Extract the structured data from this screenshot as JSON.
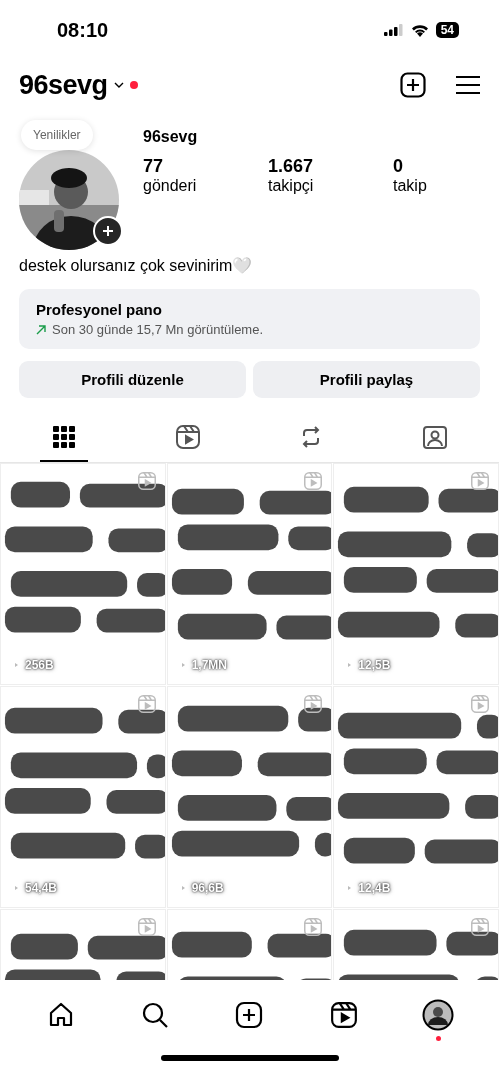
{
  "status_bar": {
    "time": "08:10",
    "battery": "54"
  },
  "header": {
    "username": "96sevg",
    "has_notification": true
  },
  "profile": {
    "note": "Yenilikler",
    "name": "96sevg",
    "stats": [
      {
        "value": "77",
        "label": "gönderi"
      },
      {
        "value": "1.667",
        "label": "takipçi"
      },
      {
        "value": "0",
        "label": "takip"
      }
    ],
    "bio": "destek olursanız çok sevinirim🤍"
  },
  "dashboard": {
    "title": "Profesyonel pano",
    "subtitle": "Son 30 günde 15,7 Mn görüntüleme."
  },
  "buttons": [
    "Profili düzenle",
    "Profili paylaş"
  ],
  "tabs": [
    {
      "kind": "grid",
      "selected": true
    },
    {
      "kind": "reels",
      "selected": false
    },
    {
      "kind": "reposts",
      "selected": false
    },
    {
      "kind": "tagged",
      "selected": false
    }
  ],
  "posts": [
    {
      "kind": "picture",
      "views": "256B"
    },
    {
      "kind": "picture",
      "views": "1,7MN"
    },
    {
      "kind": "picture",
      "views": "12,5B"
    },
    {
      "kind": "picture",
      "views": "54,4B"
    },
    {
      "kind": "picture",
      "views": "96,6B"
    },
    {
      "kind": "picture",
      "views": "12,4B"
    },
    {
      "kind": "picture"
    },
    {
      "kind": "picture"
    },
    {
      "kind": "picture"
    }
  ],
  "bottom_nav": [
    {
      "kind": "home",
      "selected": false
    },
    {
      "kind": "search",
      "selected": false
    },
    {
      "kind": "create",
      "selected": false
    },
    {
      "kind": "reels",
      "selected": false
    },
    {
      "kind": "profile",
      "selected": true,
      "has_notification": true
    }
  ]
}
